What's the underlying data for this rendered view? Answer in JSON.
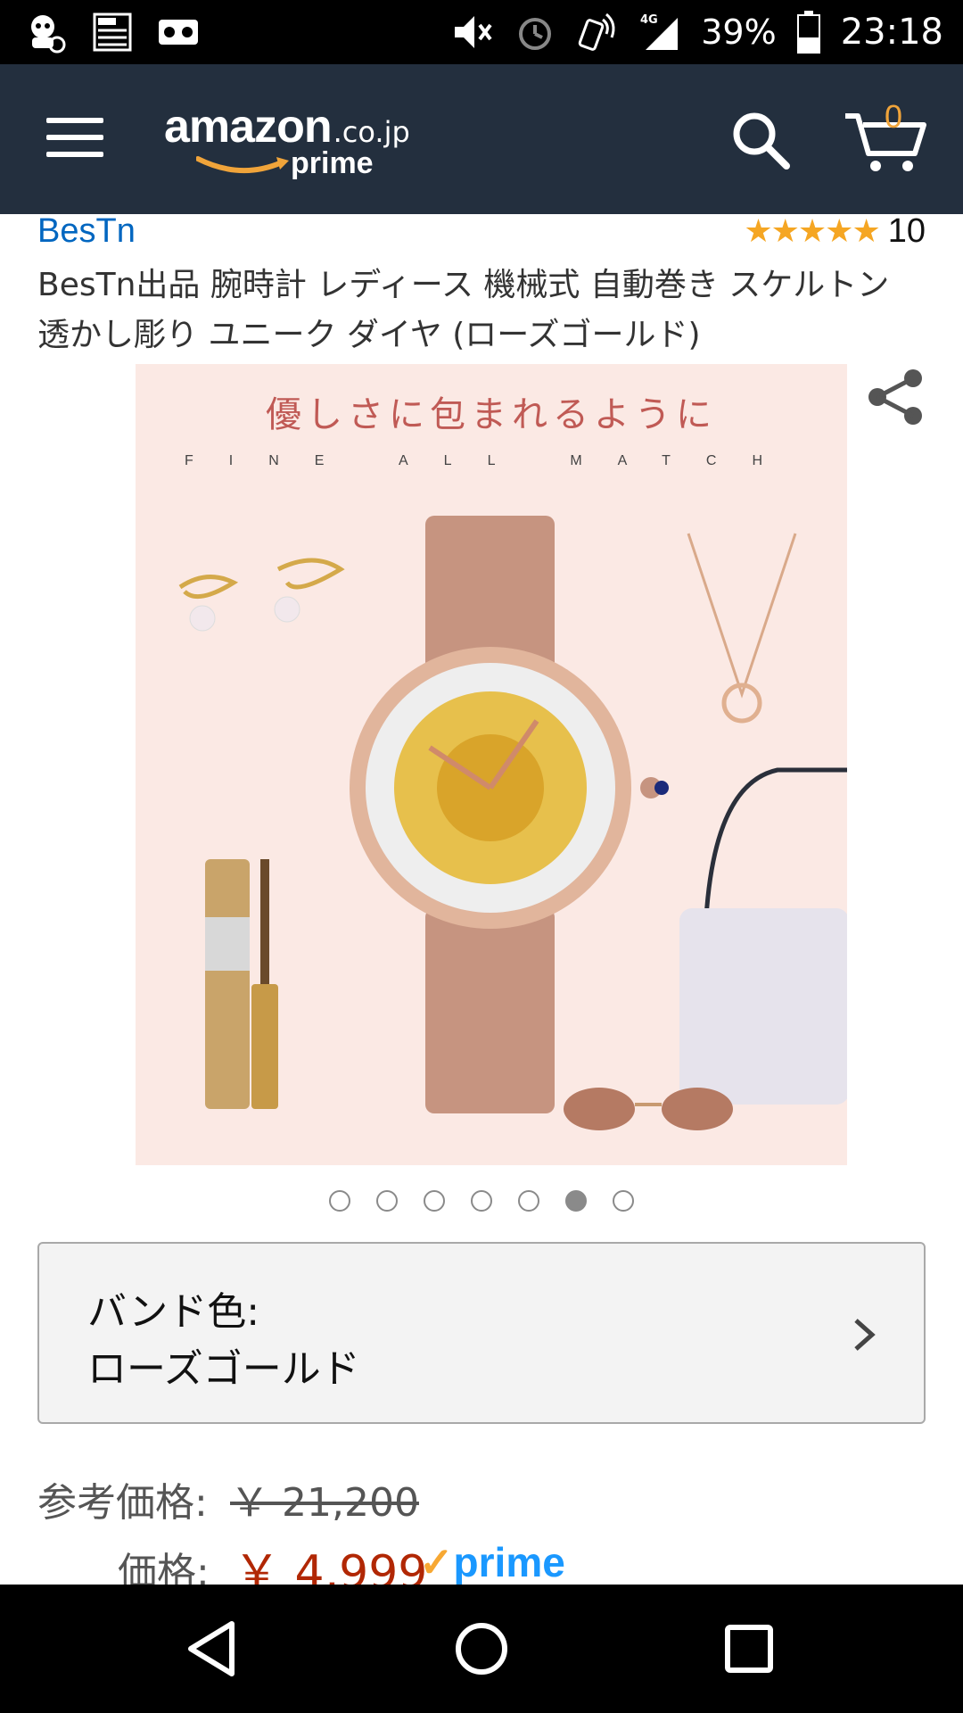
{
  "status_bar": {
    "left_icons": [
      "app-notification-icon",
      "newspaper-icon",
      "voicemail-icon"
    ],
    "right_icons": [
      "mute-icon",
      "alarm-icon",
      "nfc-icon",
      "signal-4g-icon"
    ],
    "network": "4G",
    "battery_percent": "39%",
    "time": "23:18"
  },
  "header": {
    "logo_text": "amazon",
    "logo_domain": ".co.jp",
    "logo_sub": "prime",
    "cart_count": "0"
  },
  "product": {
    "brand": "BesTn",
    "rating_stars": "★★★★★",
    "rating_value": 5,
    "review_count": "10",
    "title": "BesTn出品 腕時計 レディース 機械式 自動巻き スケルトン 透かし彫り ユニーク ダイヤ (ローズゴールド)",
    "image_heading": "優しさに包まれるように",
    "image_subheading": "FINE ALL MATCH",
    "image_count": 7,
    "active_image_index": 5
  },
  "variant": {
    "label": "バンド色:",
    "value": "ローズゴールド"
  },
  "pricing": {
    "reference_label": "参考価格:",
    "reference_price": "￥ 21,200",
    "price_label": "価格:",
    "price": "￥ 4,999",
    "prime_label": "prime"
  },
  "colors": {
    "header_bg": "#232f3e",
    "link": "#0066c0",
    "price": "#b12704",
    "star": "#f5a623",
    "prime_blue": "#1a98ff",
    "cart_orange": "#f0a43a"
  }
}
